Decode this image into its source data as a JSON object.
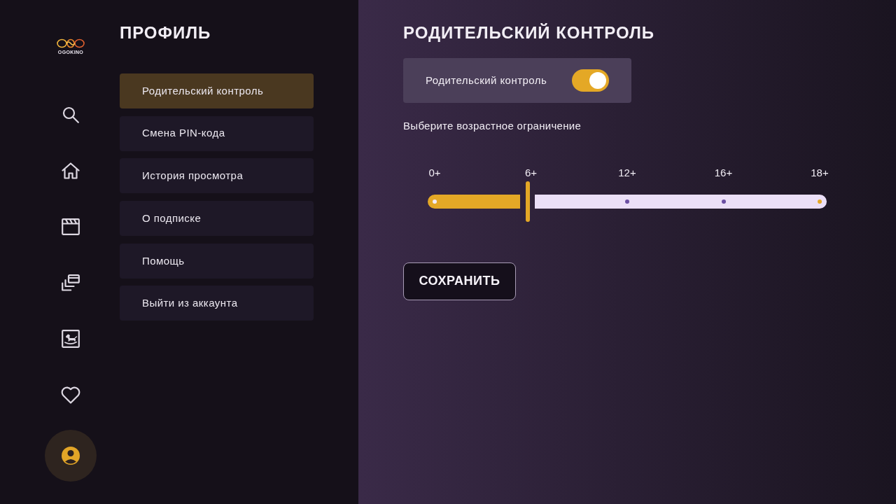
{
  "logo": {
    "text": "OGOKINO"
  },
  "nav_items": [
    {
      "selected": false
    },
    {
      "selected": false
    },
    {
      "selected": false
    },
    {
      "selected": false
    },
    {
      "selected": false
    },
    {
      "selected": false
    },
    {
      "selected": true
    }
  ],
  "profile": {
    "title": "ПРОФИЛЬ",
    "menu": [
      {
        "label": "Родительский контроль",
        "selected": true
      },
      {
        "label": "Смена PIN-кода",
        "selected": false
      },
      {
        "label": "История просмотра",
        "selected": false
      },
      {
        "label": "О подписке",
        "selected": false
      },
      {
        "label": "Помощь",
        "selected": false
      },
      {
        "label": "Выйти из аккаунта",
        "selected": false
      }
    ]
  },
  "content": {
    "title": "РОДИТЕЛЬСКИЙ КОНТРОЛЬ",
    "toggle": {
      "label": "Родительский контроль",
      "on": true
    },
    "age_prompt": "Выберите возрастное ограничение",
    "age_slider": {
      "level": 0.25,
      "stops": [
        {
          "label": "0+",
          "color": "#f3ecfb"
        },
        {
          "label": "6+"
        },
        {
          "label": "12+",
          "color": "#6b4fa3"
        },
        {
          "label": "16+",
          "color": "#6b4fa3"
        },
        {
          "label": "18+",
          "color": "#e4a826"
        }
      ]
    },
    "save_button": "СОХРАНИТЬ"
  }
}
